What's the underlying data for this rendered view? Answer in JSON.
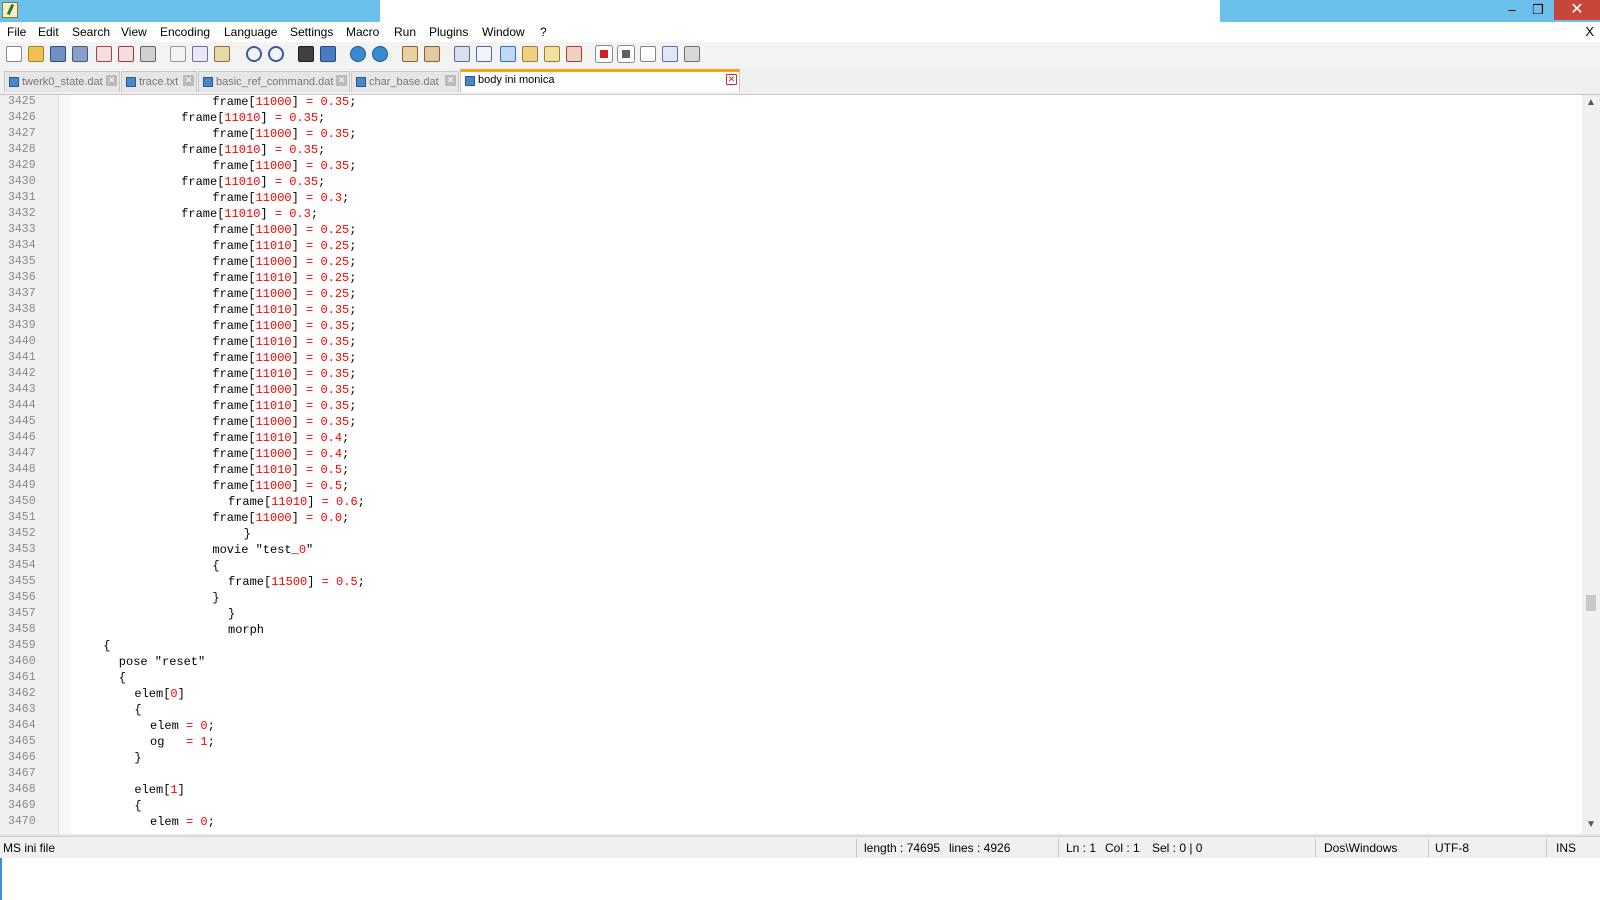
{
  "menu": {
    "items": [
      "File",
      "Edit",
      "Search",
      "View",
      "Encoding",
      "Language",
      "Settings",
      "Macro",
      "Run",
      "Plugins",
      "Window",
      "?"
    ],
    "close_label": "X"
  },
  "window_buttons": {
    "minimize": "–",
    "maximize": "❐",
    "close": "✕"
  },
  "tabs": [
    {
      "label": "twerk0_state.dat",
      "active": false
    },
    {
      "label": "trace.txt",
      "active": false
    },
    {
      "label": "basic_ref_command.dat",
      "active": false
    },
    {
      "label": "char_base.dat",
      "active": false
    },
    {
      "label": "body ini monica",
      "active": true
    }
  ],
  "tab_close_glyph": "✕",
  "editor": {
    "lines": [
      {
        "num": "3425",
        "indent": 18,
        "text": "frame[11000] = 0.35;"
      },
      {
        "num": "3426",
        "indent": 14,
        "text": "frame[11010] = 0.35;"
      },
      {
        "num": "3427",
        "indent": 18,
        "text": "frame[11000] = 0.35;"
      },
      {
        "num": "3428",
        "indent": 14,
        "text": "frame[11010] = 0.35;"
      },
      {
        "num": "3429",
        "indent": 18,
        "text": "frame[11000] = 0.35;"
      },
      {
        "num": "3430",
        "indent": 14,
        "text": "frame[11010] = 0.35;"
      },
      {
        "num": "3431",
        "indent": 18,
        "text": "frame[11000] = 0.3;"
      },
      {
        "num": "3432",
        "indent": 14,
        "text": "frame[11010] = 0.3;"
      },
      {
        "num": "3433",
        "indent": 18,
        "text": "frame[11000] = 0.25;"
      },
      {
        "num": "3434",
        "indent": 18,
        "text": "frame[11010] = 0.25;"
      },
      {
        "num": "3435",
        "indent": 18,
        "text": "frame[11000] = 0.25;"
      },
      {
        "num": "3436",
        "indent": 18,
        "text": "frame[11010] = 0.25;"
      },
      {
        "num": "3437",
        "indent": 18,
        "text": "frame[11000] = 0.25;"
      },
      {
        "num": "3438",
        "indent": 18,
        "text": "frame[11010] = 0.35;"
      },
      {
        "num": "3439",
        "indent": 18,
        "text": "frame[11000] = 0.35;"
      },
      {
        "num": "3440",
        "indent": 18,
        "text": "frame[11010] = 0.35;"
      },
      {
        "num": "3441",
        "indent": 18,
        "text": "frame[11000] = 0.35;"
      },
      {
        "num": "3442",
        "indent": 18,
        "text": "frame[11010] = 0.35;"
      },
      {
        "num": "3443",
        "indent": 18,
        "text": "frame[11000] = 0.35;"
      },
      {
        "num": "3444",
        "indent": 18,
        "text": "frame[11010] = 0.35;"
      },
      {
        "num": "3445",
        "indent": 18,
        "text": "frame[11000] = 0.35;"
      },
      {
        "num": "3446",
        "indent": 18,
        "text": "frame[11010] = 0.4;"
      },
      {
        "num": "3447",
        "indent": 18,
        "text": "frame[11000] = 0.4;"
      },
      {
        "num": "3448",
        "indent": 18,
        "text": "frame[11010] = 0.5;"
      },
      {
        "num": "3449",
        "indent": 18,
        "text": "frame[11000] = 0.5;"
      },
      {
        "num": "3450",
        "indent": 20,
        "text": "frame[11010] = 0.6;"
      },
      {
        "num": "3451",
        "indent": 18,
        "text": "frame[11000] = 0.0;"
      },
      {
        "num": "3452",
        "indent": 22,
        "text": "}"
      },
      {
        "num": "3453",
        "indent": 18,
        "text": "movie \"test_0\""
      },
      {
        "num": "3454",
        "indent": 18,
        "text": "{"
      },
      {
        "num": "3455",
        "indent": 20,
        "text": "frame[11500] = 0.5;"
      },
      {
        "num": "3456",
        "indent": 18,
        "text": "}"
      },
      {
        "num": "3457",
        "indent": 20,
        "text": "}"
      },
      {
        "num": "3458",
        "indent": 20,
        "text": "morph"
      },
      {
        "num": "3459",
        "indent": 4,
        "text": "{"
      },
      {
        "num": "3460",
        "indent": 6,
        "text": "pose \"reset\""
      },
      {
        "num": "3461",
        "indent": 6,
        "text": "{"
      },
      {
        "num": "3462",
        "indent": 8,
        "text": "elem[0]"
      },
      {
        "num": "3463",
        "indent": 8,
        "text": "{"
      },
      {
        "num": "3464",
        "indent": 10,
        "text": "elem = 0;"
      },
      {
        "num": "3465",
        "indent": 10,
        "text": "og   = 1;"
      },
      {
        "num": "3466",
        "indent": 8,
        "text": "}"
      },
      {
        "num": "3467",
        "indent": 0,
        "text": ""
      },
      {
        "num": "3468",
        "indent": 8,
        "text": "elem[1]"
      },
      {
        "num": "3469",
        "indent": 8,
        "text": "{"
      },
      {
        "num": "3470",
        "indent": 10,
        "text": "elem = 0;"
      }
    ]
  },
  "scrollbar": {
    "up": "▲",
    "down": "▼"
  },
  "status": {
    "language": "MS ini file",
    "length": "length : 74695",
    "lines": "lines : 4926",
    "ln": "Ln : 1",
    "col": "Col : 1",
    "sel": "Sel : 0 | 0",
    "eol": "Dos\\Windows",
    "encoding": "UTF-8",
    "mode": "INS"
  },
  "colors": {
    "titlebar": "#6cc0ec",
    "active_tab_accent": "#f7a21b",
    "number_color": "#ff0000",
    "close_button": "#c7463c"
  }
}
